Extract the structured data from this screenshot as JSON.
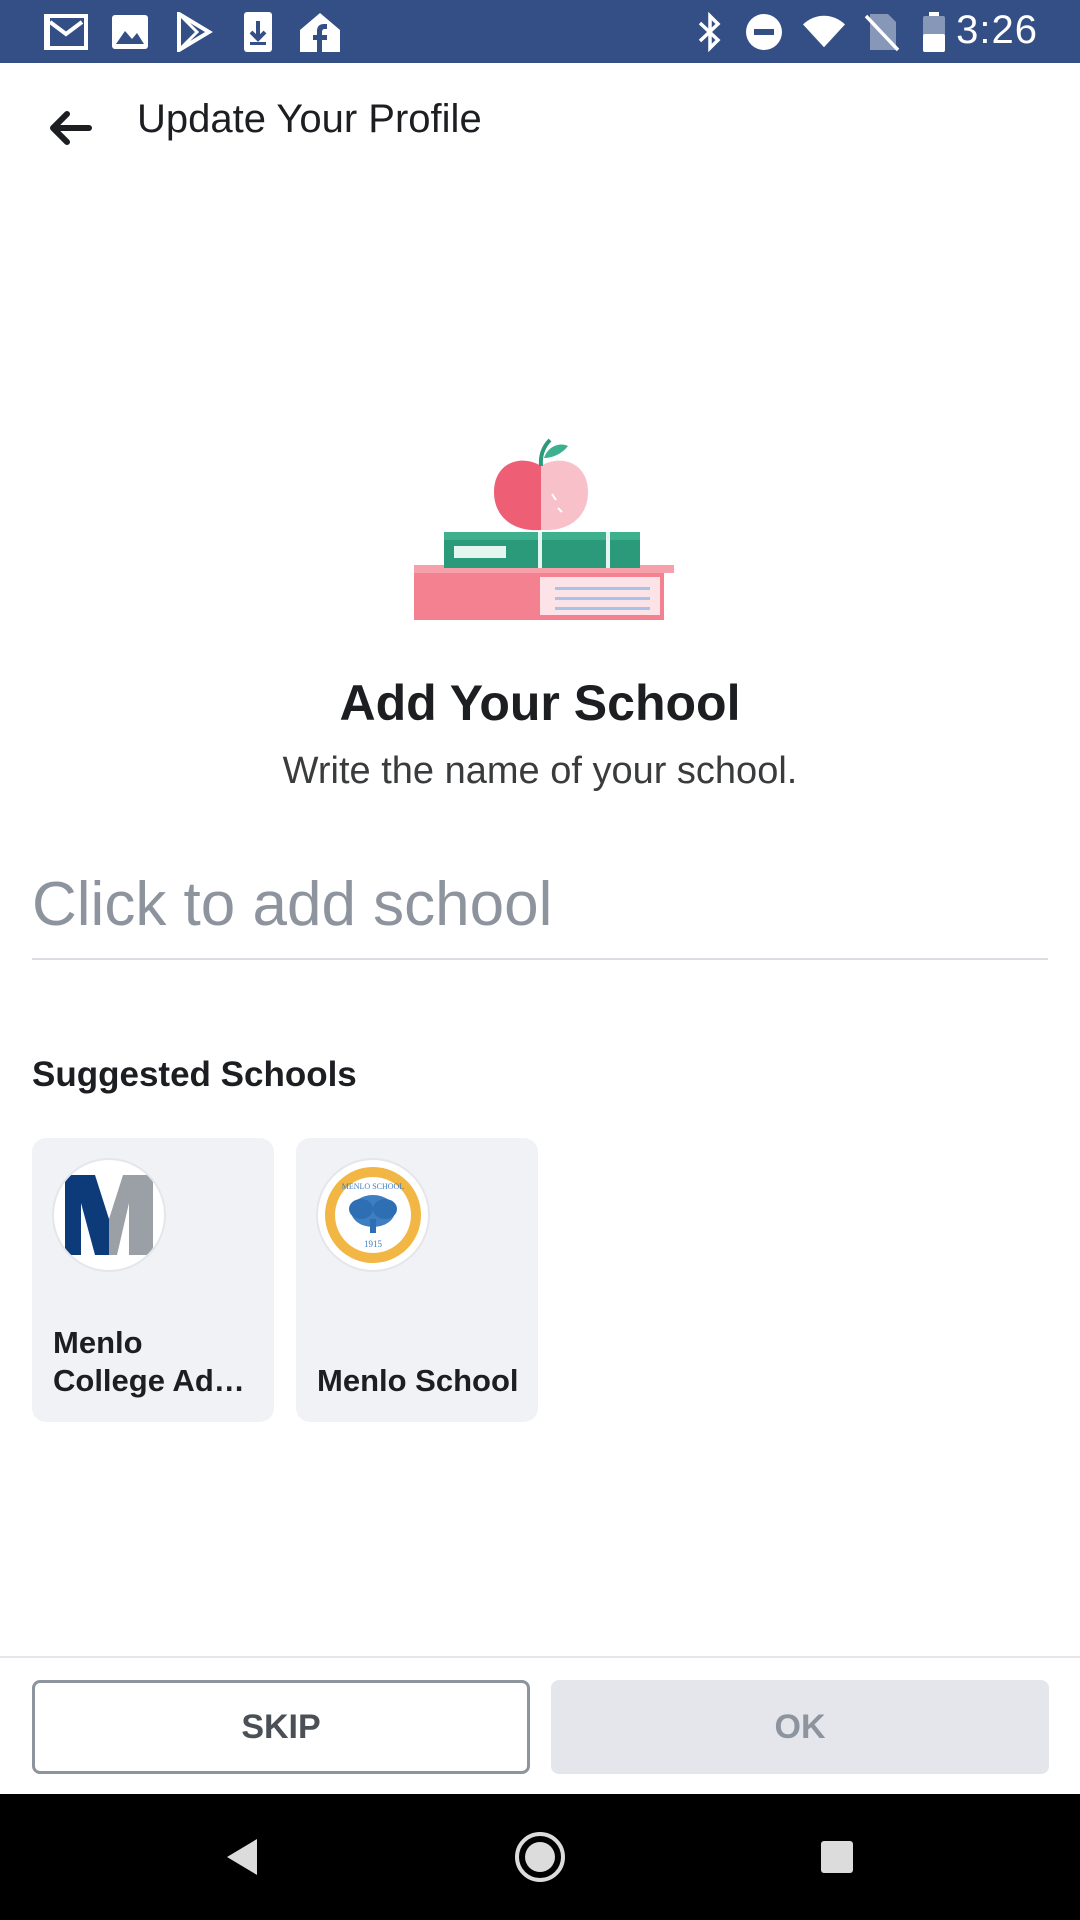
{
  "status_bar": {
    "time": "3:26",
    "left_icons": [
      "gmail-icon",
      "photos-icon",
      "play-store-icon",
      "download-icon",
      "facebook-home-icon"
    ],
    "right_icons": [
      "bluetooth-icon",
      "do-not-disturb-icon",
      "wifi-icon",
      "no-sim-icon",
      "battery-icon"
    ],
    "background": "#334f85"
  },
  "app_bar": {
    "title": "Update Your Profile"
  },
  "main": {
    "heading": "Add Your School",
    "subheading": "Write the name of your school.",
    "school_input": {
      "value": "",
      "placeholder": "Click to add school"
    },
    "suggested_title": "Suggested Schools",
    "suggested_schools": [
      {
        "name": "Menlo College Ad…",
        "logo": "menlo-college-logo"
      },
      {
        "name": "Menlo School",
        "logo": "menlo-school-seal",
        "seal_text": "MENLO SCHOOL",
        "seal_year": "1915"
      }
    ]
  },
  "footer": {
    "skip_label": "SKIP",
    "ok_label": "OK"
  },
  "nav_bar": {
    "buttons": [
      "back-triangle-icon",
      "home-circle-icon",
      "recents-square-icon"
    ]
  },
  "colors": {
    "status_bar": "#334f85",
    "text_primary": "#1c1e21",
    "placeholder": "#8d949e",
    "card_bg": "#f0f2f5",
    "ok_disabled_bg": "#e4e6eb"
  }
}
